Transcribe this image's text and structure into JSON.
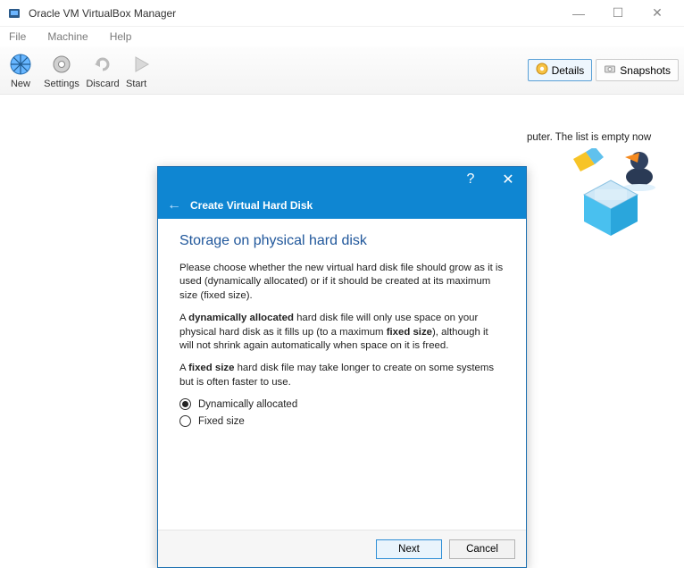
{
  "window": {
    "title": "Oracle VM VirtualBox Manager"
  },
  "menubar": {
    "items": [
      "File",
      "Machine",
      "Help"
    ]
  },
  "toolbar": {
    "new": "New",
    "settings": "Settings",
    "discard": "Discard",
    "start": "Start",
    "details": "Details",
    "snapshots": "Snapshots"
  },
  "main": {
    "hint_tail": "puter. The list is empty now"
  },
  "dialog": {
    "header_title": "Create Virtual Hard Disk",
    "heading": "Storage on physical hard disk",
    "p1": "Please choose whether the new virtual hard disk file should grow as it is used (dynamically allocated) or if it should be created at its maximum size (fixed size).",
    "p2a": "A ",
    "p2b": "dynamically allocated",
    "p2c": " hard disk file will only use space on your physical hard disk as it fills up (to a maximum ",
    "p2d": "fixed size",
    "p2e": "), although it will not shrink again automatically when space on it is freed.",
    "p3a": "A ",
    "p3b": "fixed size",
    "p3c": " hard disk file may take longer to create on some systems but is often faster to use.",
    "opt1": "Dynamically allocated",
    "opt2": "Fixed size",
    "next": "Next",
    "cancel": "Cancel"
  }
}
